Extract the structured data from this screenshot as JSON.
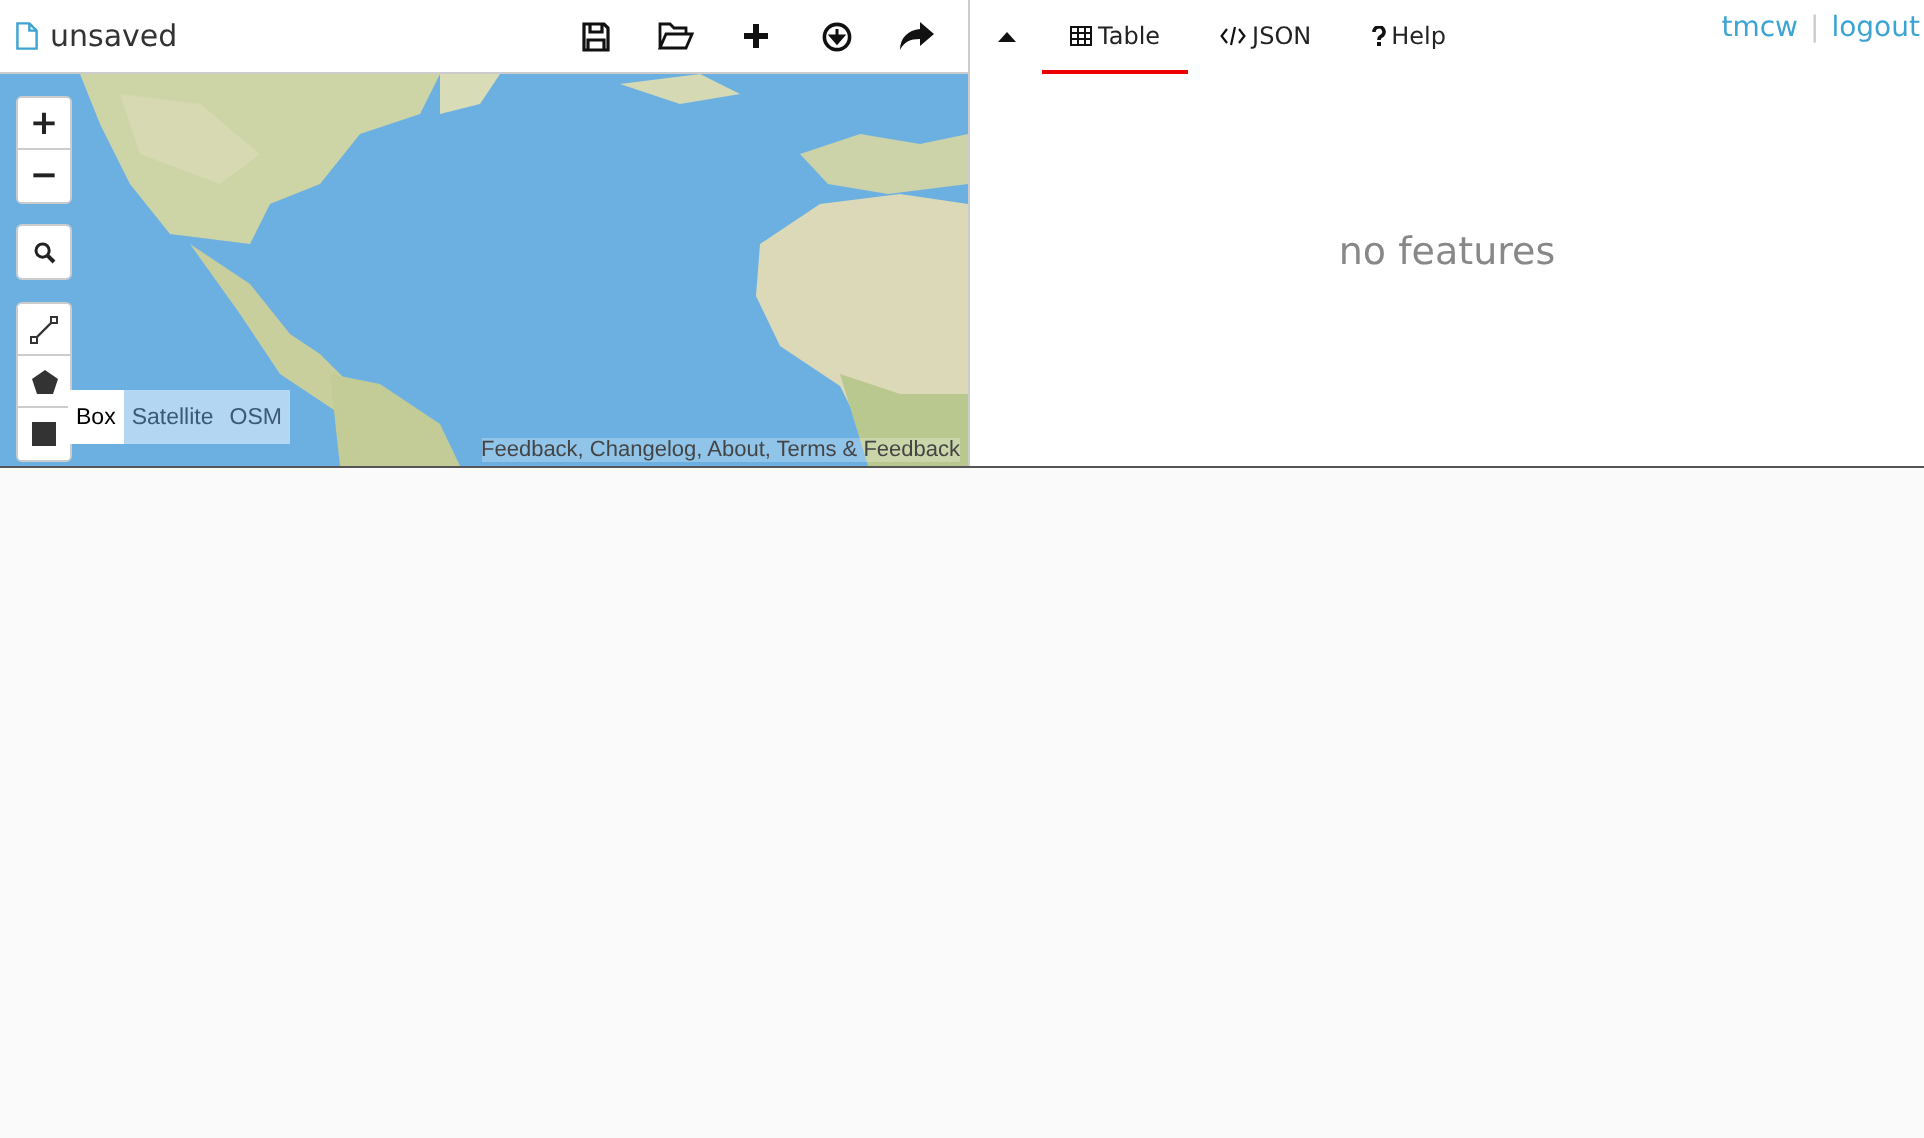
{
  "file": {
    "name": "unsaved"
  },
  "toolbar": [
    {
      "kind": "save"
    },
    {
      "kind": "open"
    },
    {
      "kind": "add"
    },
    {
      "kind": "download"
    },
    {
      "kind": "share"
    }
  ],
  "map": {
    "zoom": [
      "+",
      "−"
    ],
    "draw_tools": [
      {
        "kind": "line"
      },
      {
        "kind": "polygon"
      },
      {
        "kind": "rectangle"
      }
    ],
    "layers": [
      {
        "label": "Box",
        "selected": true
      },
      {
        "label": "Satellite",
        "selected": false
      },
      {
        "label": "OSM",
        "selected": false
      }
    ],
    "attribution": "Feedback, Changelog, About, Terms & Feedback"
  },
  "tabs": [
    {
      "label": "Table",
      "kind": "table",
      "selected": true
    },
    {
      "label": "JSON",
      "kind": "code",
      "selected": false
    },
    {
      "label": "Help",
      "kind": "help",
      "selected": false
    }
  ],
  "user": {
    "name": "tmcw",
    "separator": "|",
    "logout": "logout"
  },
  "empty_message": "no features"
}
